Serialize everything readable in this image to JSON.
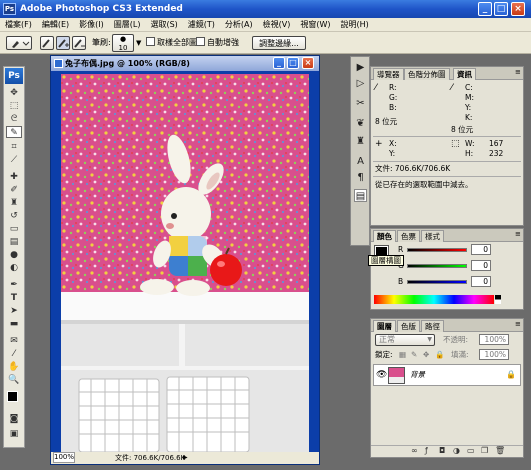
{
  "window": {
    "title": "Adobe Photoshop CS3 Extended",
    "app_icon_text": "Ps"
  },
  "menubar": {
    "items": [
      "檔案(F)",
      "編輯(E)",
      "影像(I)",
      "圖層(L)",
      "選取(S)",
      "濾鏡(T)",
      "分析(A)",
      "檢視(V)",
      "視窗(W)",
      "說明(H)"
    ]
  },
  "options_bar": {
    "brush_label": "筆刷:",
    "brush_size": "10",
    "sample_all_layers_label": "取樣全部圖層",
    "auto_enhance_label": "自動增強",
    "refine_edge_button": "調整邊緣..."
  },
  "toolbox": {
    "logo": "Ps"
  },
  "document": {
    "title": "兔子布偶.jpg @ 100% (RGB/8)",
    "zoom": "100%",
    "file_info": "文件: 706.6K/706.6K"
  },
  "info_panel": {
    "tabs": [
      "導覽器",
      "色階分佈圖",
      "資訊"
    ],
    "active_tab": "資訊",
    "rgb_labels": [
      "R:",
      "G:",
      "B:"
    ],
    "cmyk_labels": [
      "C:",
      "M:",
      "Y:",
      "K:"
    ],
    "bit_depth_left": "8 位元",
    "bit_depth_right": "8 位元",
    "x_label": "X:",
    "y_label": "Y:",
    "w_label": "W:",
    "h_label": "H:",
    "w_value": "167",
    "h_value": "232",
    "doc_size": "文件: 706.6K/706.6K",
    "hint": "從已存在的選取範圍中減去。"
  },
  "color_panel": {
    "tabs": [
      "顏色",
      "色票",
      "樣式"
    ],
    "active_tab": "顏色",
    "channels": [
      {
        "label": "R",
        "value": "0"
      },
      {
        "label": "G",
        "value": "0"
      },
      {
        "label": "B",
        "value": "0"
      }
    ],
    "tooltip": "圖層構圖",
    "colors": {
      "r_track": "#c81818",
      "g_track": "#18b418",
      "b_track": "#1830c8"
    }
  },
  "layers_panel": {
    "tabs": [
      "圖層",
      "色版",
      "路徑"
    ],
    "active_tab": "圖層",
    "blend_mode": "正常",
    "opacity_label": "不透明:",
    "opacity_value": "100%",
    "lock_label": "鎖定:",
    "fill_label": "填滿:",
    "fill_value": "100%",
    "layer_name": "背景"
  },
  "colors": {
    "title_blue": "#1f55c8",
    "wallpaper_pink": "#d94f8d",
    "panel_bg": "#e4e2d6"
  }
}
